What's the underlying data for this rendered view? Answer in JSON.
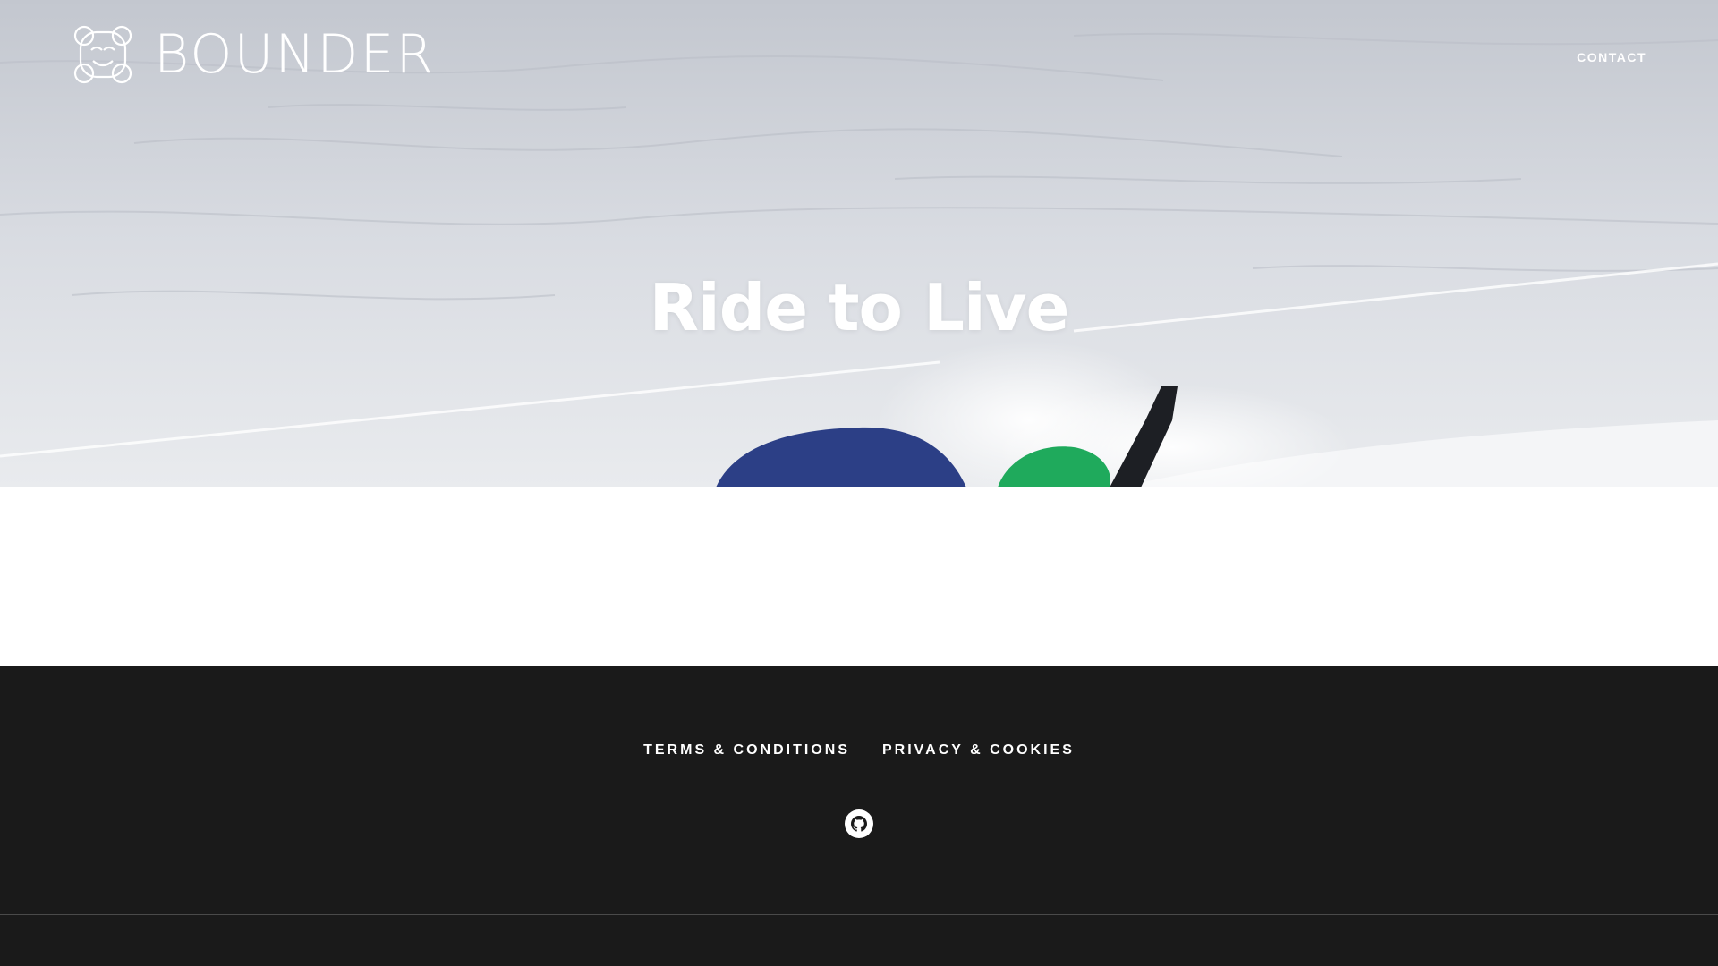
{
  "header": {
    "logo_text": "BOUNDER",
    "nav": {
      "contact_label": "CONTACT"
    }
  },
  "hero": {
    "title": "Ride to Live"
  },
  "footer": {
    "links": [
      {
        "label": "TERMS & CONDITIONS"
      },
      {
        "label": "PRIVACY & COOKIES"
      }
    ],
    "social": {
      "icon": "github-icon"
    }
  },
  "colors": {
    "footer_bg": "#1a1a1a",
    "hero_text": "#ffffff",
    "content_bg": "#ffffff"
  }
}
